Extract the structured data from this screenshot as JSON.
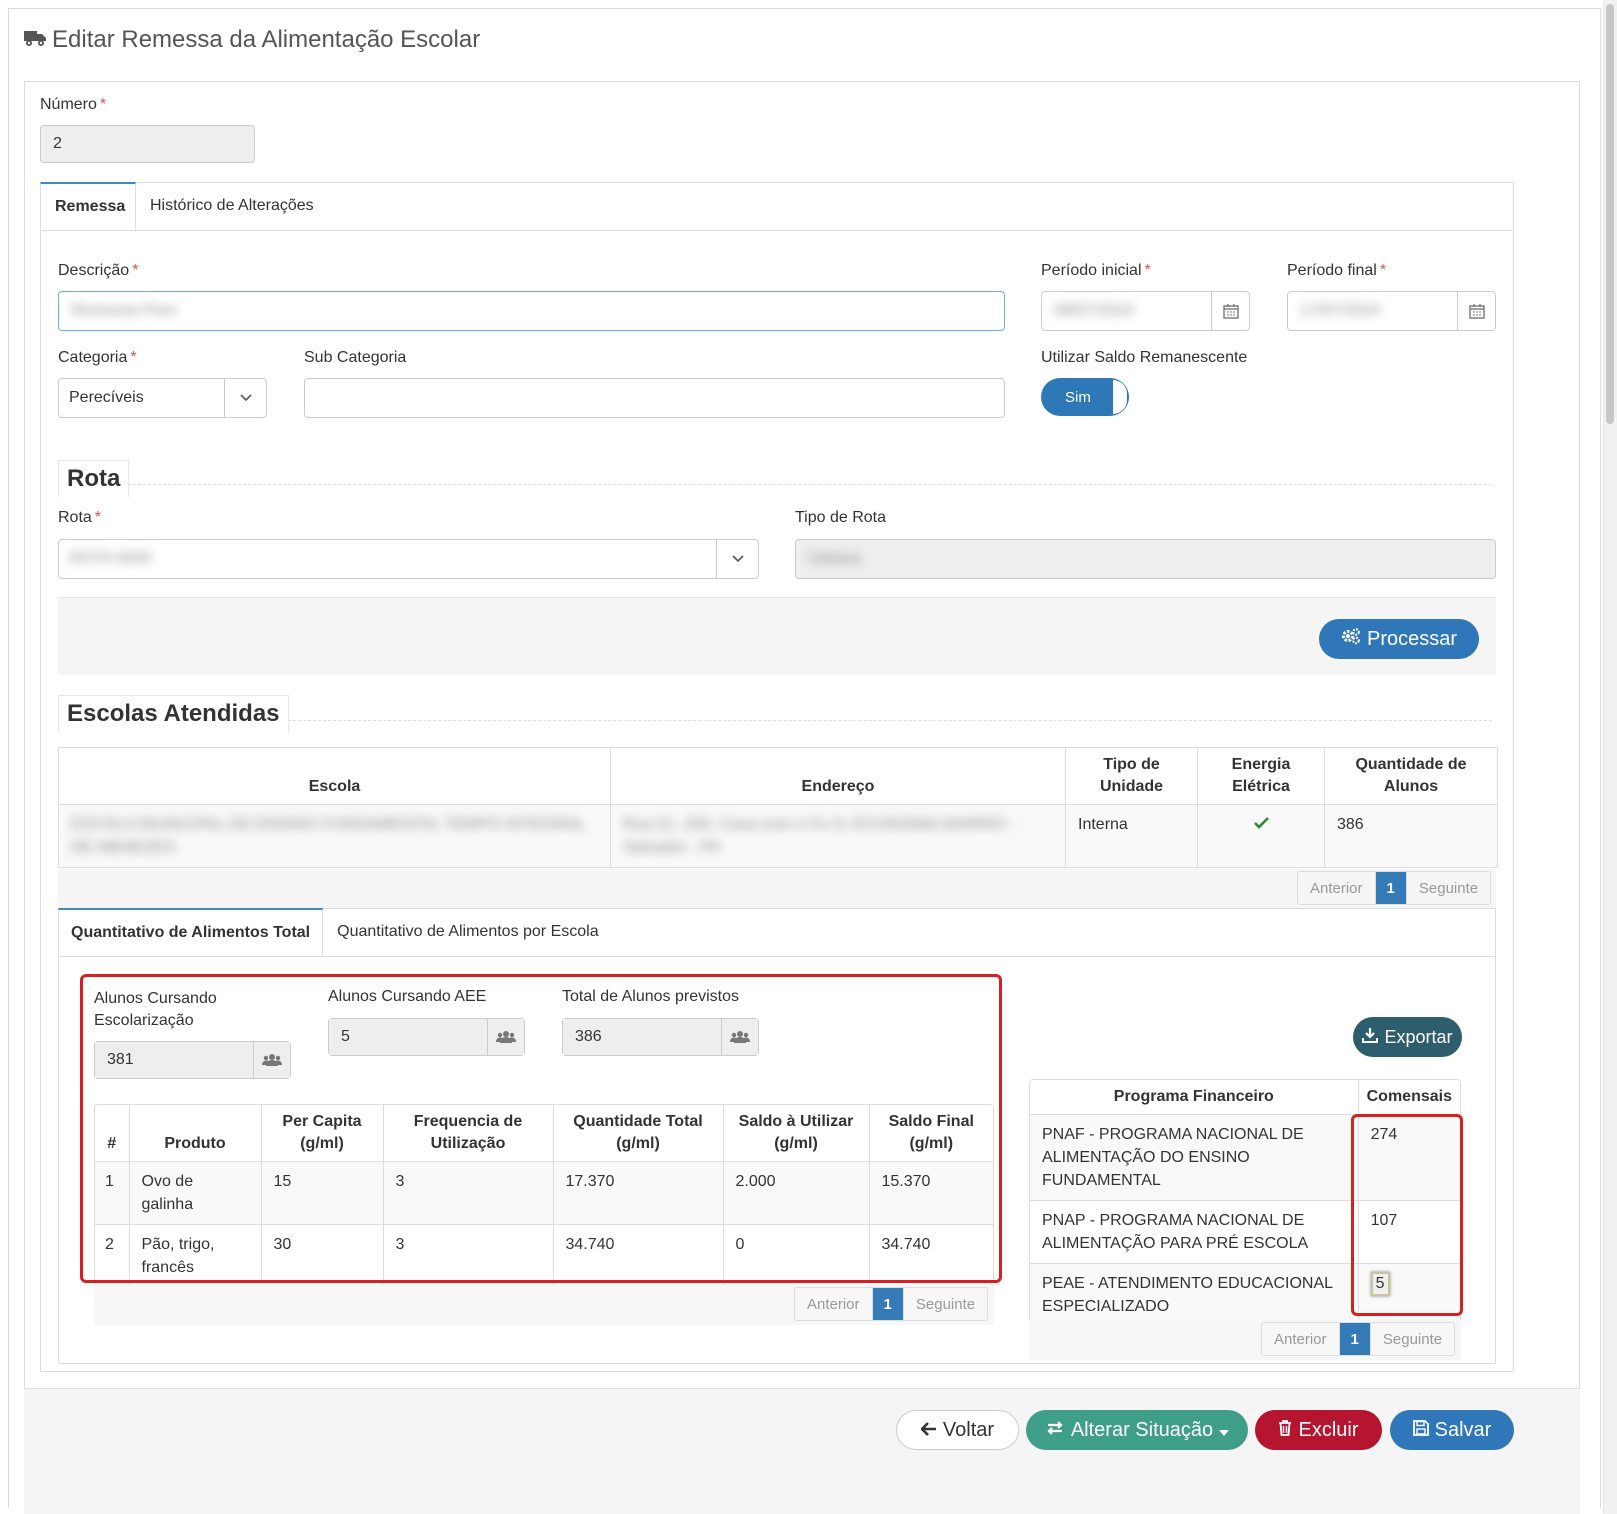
{
  "page": {
    "title": "Editar Remessa da Alimentação Escolar"
  },
  "numero": {
    "label": "Número",
    "value": "2"
  },
  "tabs": [
    {
      "label": "Remessa"
    },
    {
      "label": "Histórico de Alterações"
    }
  ],
  "form": {
    "descricao": {
      "label": "Descrição",
      "value": "Remessa Pere"
    },
    "periodo_inicial": {
      "label": "Período inicial",
      "value": "08/07/2024"
    },
    "periodo_final": {
      "label": "Período final",
      "value": "17/07/2024"
    },
    "categoria": {
      "label": "Categoria",
      "value": "Perecíveis"
    },
    "sub_categoria": {
      "label": "Sub Categoria",
      "value": ""
    },
    "utilizar_saldo": {
      "label": "Utilizar Saldo Remanescente",
      "value": "Sim"
    }
  },
  "rota_section": {
    "title": "Rota",
    "rota": {
      "label": "Rota",
      "value": "ROTA 0000"
    },
    "tipo_rota": {
      "label": "Tipo de Rota",
      "value": "Urbana"
    },
    "processar_button": "Processar"
  },
  "escolas": {
    "title": "Escolas Atendidas",
    "columns": [
      "Escola",
      "Endereço",
      "Tipo de Unidade",
      "Energia Elétrica",
      "Quantidade de Alunos"
    ],
    "rows": [
      {
        "escola": "ESCOLA MUNICIPAL DE ENSINO FUNDAMENTAL TEMPO INTEGRAL DE MENEZES",
        "endereco": "Rua 01, 200, Casa com o Fe O, ECONOMIA BAIRRO - Salvador - PA",
        "tipo": "Interna",
        "energia": "check-icon",
        "quantidade": "386"
      }
    ],
    "pager": {
      "prev": "Anterior",
      "current": "1",
      "next": "Seguinte"
    }
  },
  "sub_tabs": [
    {
      "label": "Quantitativo de Alimentos Total"
    },
    {
      "label": "Quantitativo de Alimentos por Escola"
    }
  ],
  "counts": {
    "escolarizacao": {
      "label": "Alunos Cursando Escolarização",
      "value": "381"
    },
    "aee": {
      "label": "Alunos Cursando AEE",
      "value": "5"
    },
    "total": {
      "label": "Total de Alunos previstos",
      "value": "386"
    }
  },
  "produtos": {
    "columns": [
      "#",
      "Produto",
      "Per Capita (g/ml)",
      "Frequencia de Utilização",
      "Quantidade Total (g/ml)",
      "Saldo à Utilizar (g/ml)",
      "Saldo Final (g/ml)"
    ],
    "rows": [
      {
        "n": "1",
        "produto": "Ovo de galinha",
        "per_capita": "15",
        "frequencia": "3",
        "qtd_total": "17.370",
        "saldo_utilizar": "2.000",
        "saldo_final": "15.370"
      },
      {
        "n": "2",
        "produto": "Pão, trigo, francês",
        "per_capita": "30",
        "frequencia": "3",
        "qtd_total": "34.740",
        "saldo_utilizar": "0",
        "saldo_final": "34.740"
      }
    ],
    "pager": {
      "prev": "Anterior",
      "current": "1",
      "next": "Seguinte"
    }
  },
  "programas": {
    "export_button": "Exportar",
    "columns": [
      "Programa Financeiro",
      "Comensais"
    ],
    "rows": [
      {
        "programa": "PNAF - PROGRAMA NACIONAL DE ALIMENTAÇÃO DO ENSINO FUNDAMENTAL",
        "comensais": "274"
      },
      {
        "programa": "PNAP - PROGRAMA NACIONAL DE ALIMENTAÇÃO PARA PRÉ ESCOLA",
        "comensais": "107"
      },
      {
        "programa": "PEAE - ATENDIMENTO EDUCACIONAL ESPECIALIZADO",
        "comensais": "5"
      }
    ],
    "pager": {
      "prev": "Anterior",
      "current": "1",
      "next": "Seguinte"
    }
  },
  "footer": {
    "voltar": "Voltar",
    "alterar": "Alterar Situação",
    "excluir": "Excluir",
    "salvar": "Salvar"
  },
  "colors": {
    "primary": "#3c7ebf",
    "teal": "#3f9e87",
    "danger": "#b5152e",
    "export": "#2e5d6e",
    "highlight": "#d62020"
  }
}
